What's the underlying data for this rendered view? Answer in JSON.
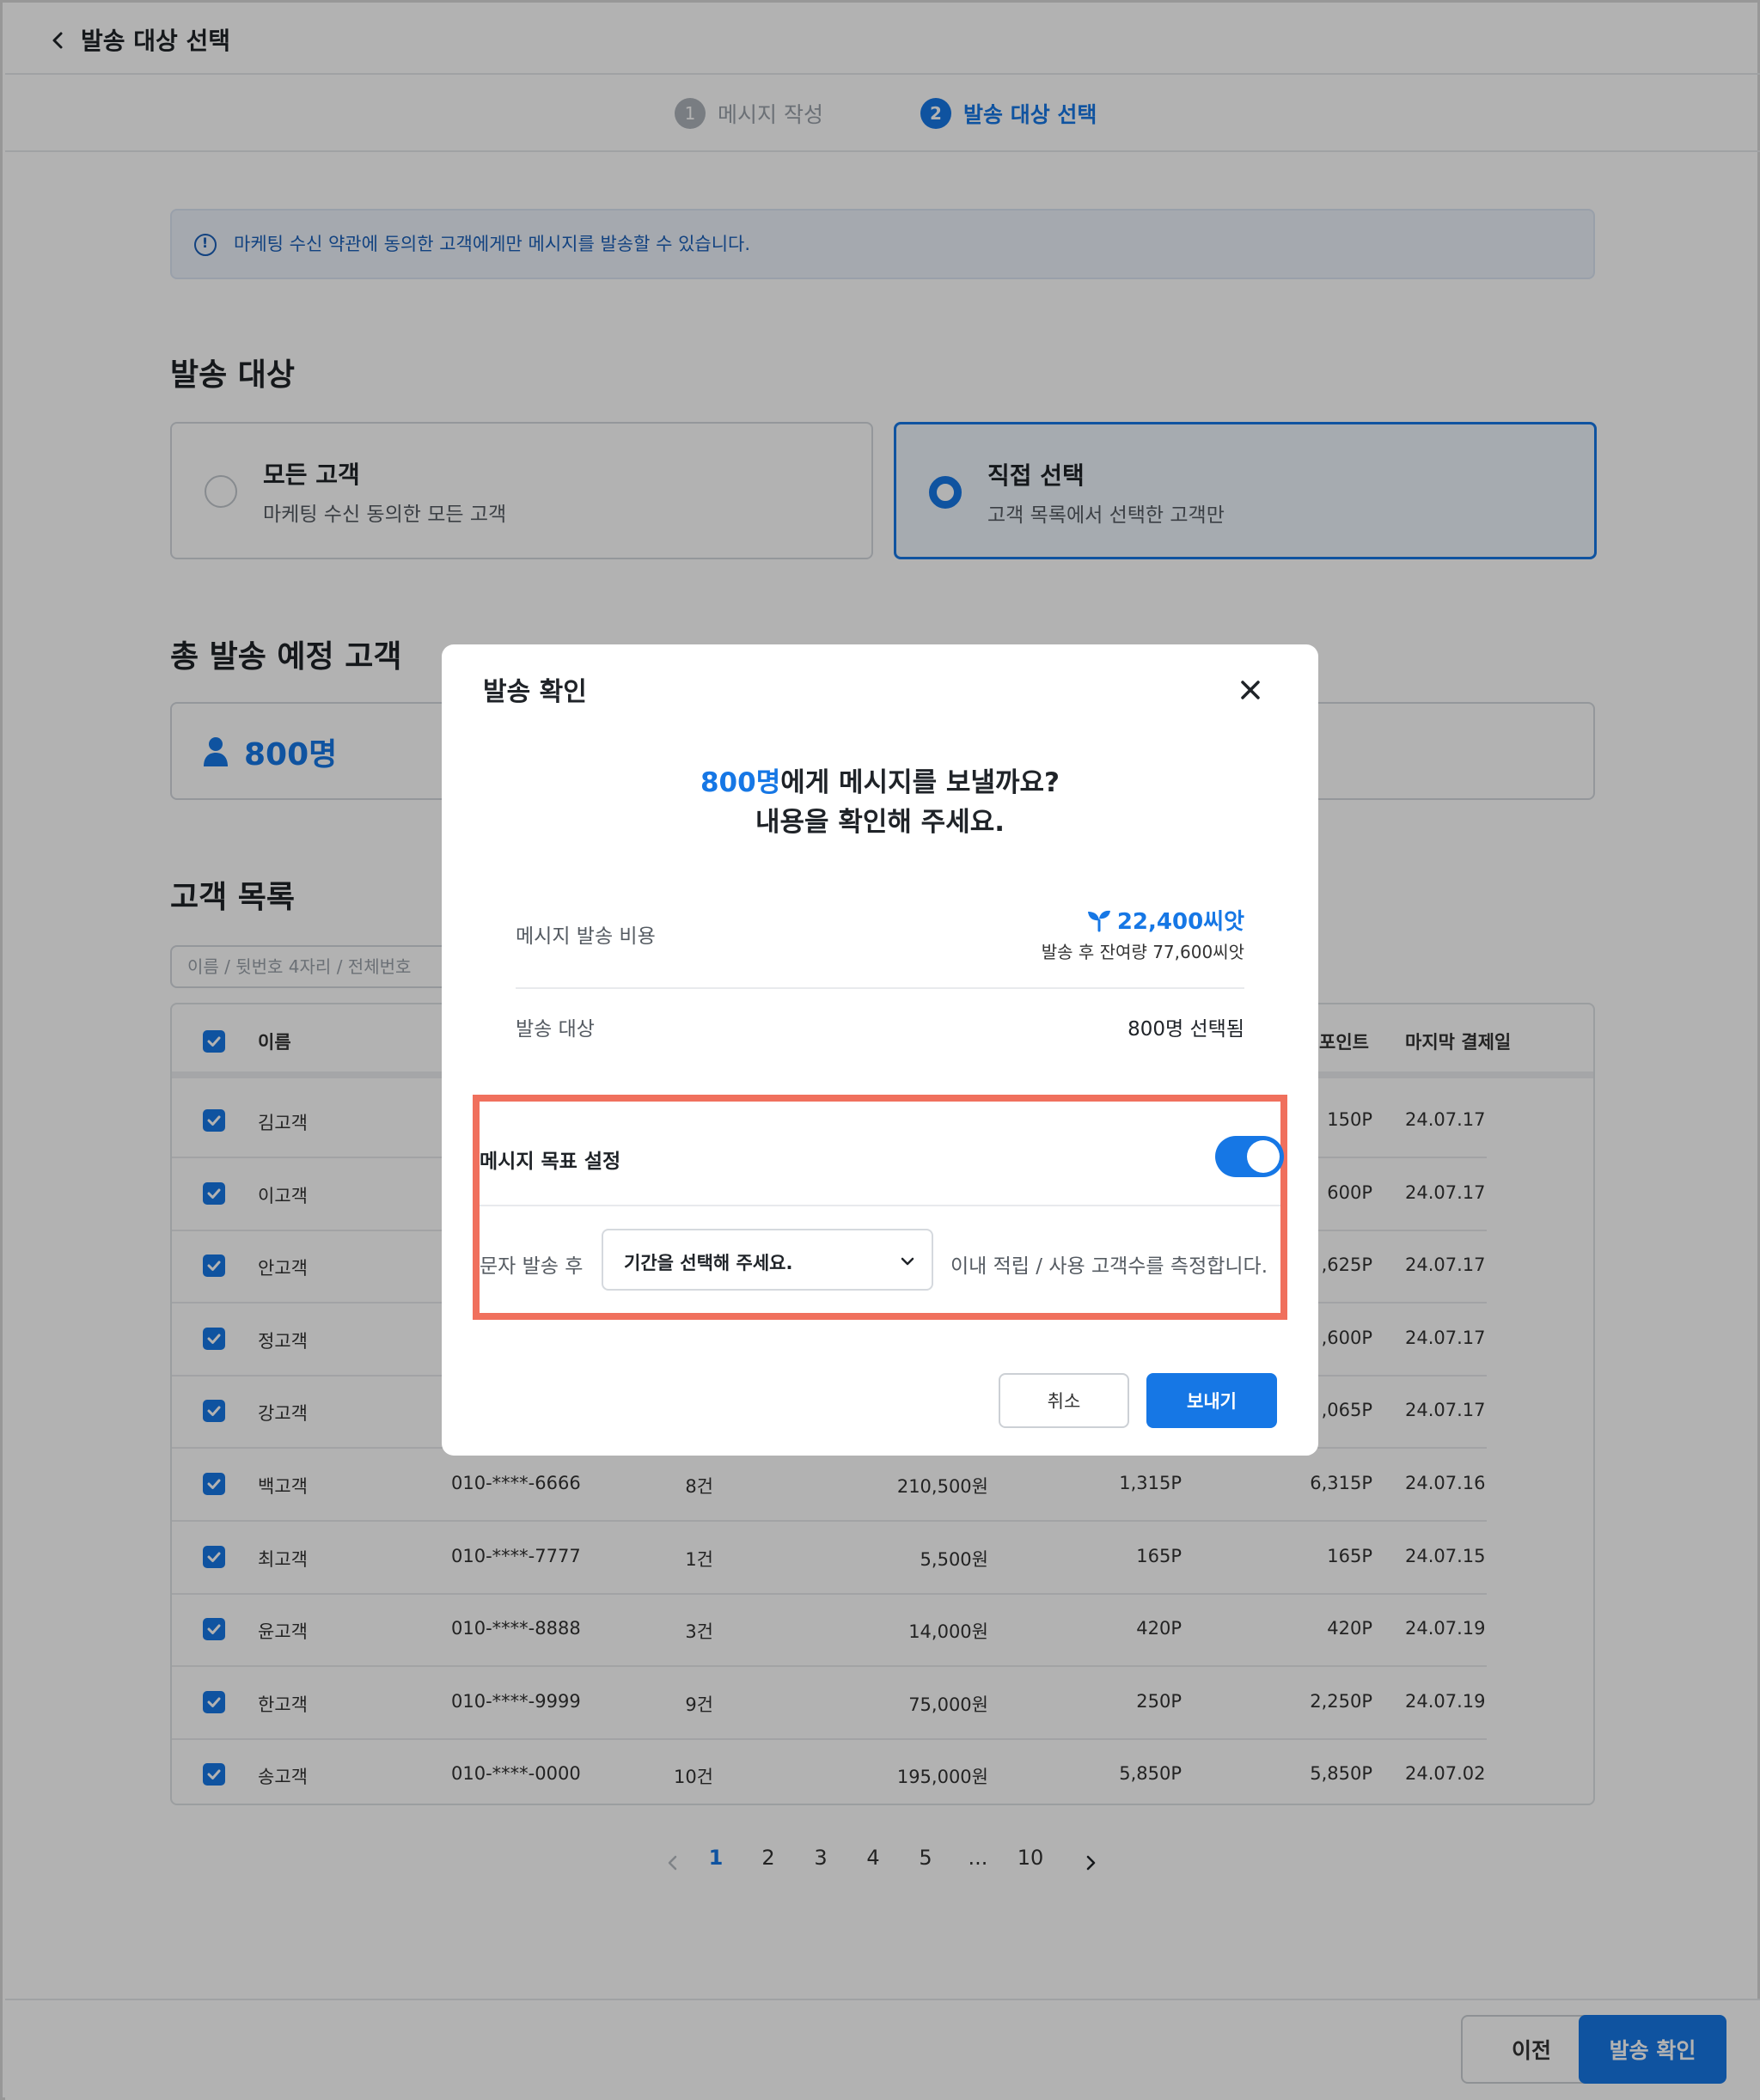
{
  "header": {
    "title": "발송 대상 선택"
  },
  "stepper": {
    "steps": [
      {
        "num": "1",
        "label": "메시지 작성"
      },
      {
        "num": "2",
        "label": "발송 대상 선택"
      }
    ]
  },
  "notice": {
    "text": "마케팅 수신 약관에 동의한 고객에게만 메시지를 발송할 수 있습니다."
  },
  "target": {
    "title": "발송 대상",
    "options": [
      {
        "title": "모든 고객",
        "desc": "마케팅 수신 동의한 모든 고객"
      },
      {
        "title": "직접 선택",
        "desc": "고객 목록에서 선택한 고객만"
      }
    ]
  },
  "total": {
    "title": "총 발송 예정 고객",
    "value": "800명"
  },
  "customers": {
    "title": "고객 목록",
    "search_placeholder": "이름 / 뒷번호 4자리 / 전체번호",
    "headers": {
      "name": "이름",
      "points": "포인트",
      "last_payment": "마지막 결제일"
    },
    "rows": [
      {
        "name": "김고객",
        "phone": "",
        "count": "",
        "amount": "",
        "earned": "",
        "points": "150P",
        "date": "24.07.17"
      },
      {
        "name": "이고객",
        "phone": "",
        "count": "",
        "amount": "",
        "earned": "",
        "points": "600P",
        "date": "24.07.17"
      },
      {
        "name": "안고객",
        "phone": "",
        "count": "",
        "amount": "",
        "earned": "",
        "points": ",625P",
        "date": "24.07.17"
      },
      {
        "name": "정고객",
        "phone": "",
        "count": "",
        "amount": "",
        "earned": "",
        "points": ",600P",
        "date": "24.07.17"
      },
      {
        "name": "강고객",
        "phone": "",
        "count": "",
        "amount": "",
        "earned": "",
        "points": ",065P",
        "date": "24.07.17"
      },
      {
        "name": "백고객",
        "phone": "010-****-6666",
        "count": "8건",
        "amount": "210,500원",
        "earned": "1,315P",
        "points": "6,315P",
        "date": "24.07.16"
      },
      {
        "name": "최고객",
        "phone": "010-****-7777",
        "count": "1건",
        "amount": "5,500원",
        "earned": "165P",
        "points": "165P",
        "date": "24.07.15"
      },
      {
        "name": "윤고객",
        "phone": "010-****-8888",
        "count": "3건",
        "amount": "14,000원",
        "earned": "420P",
        "points": "420P",
        "date": "24.07.19"
      },
      {
        "name": "한고객",
        "phone": "010-****-9999",
        "count": "9건",
        "amount": "75,000원",
        "earned": "250P",
        "points": "2,250P",
        "date": "24.07.19"
      },
      {
        "name": "송고객",
        "phone": "010-****-0000",
        "count": "10건",
        "amount": "195,000원",
        "earned": "5,850P",
        "points": "5,850P",
        "date": "24.07.02"
      }
    ]
  },
  "pagination": {
    "pages": [
      "1",
      "2",
      "3",
      "4",
      "5",
      "...",
      "10"
    ],
    "active": "1"
  },
  "footer": {
    "prev_label": "이전",
    "confirm_label": "발송 확인"
  },
  "modal": {
    "title": "발송 확인",
    "headline_count": "800명",
    "headline_rest": "에게 메시지를 보낼까요?",
    "headline_line2": "내용을 확인해 주세요.",
    "cost_label": "메시지 발송 비용",
    "cost_value": "22,400씨앗",
    "cost_remaining": "발송 후 잔여량 77,600씨앗",
    "target_label": "발송 대상",
    "target_value": "800명 선택됨",
    "goal_title": "메시지 목표 설정",
    "goal_enabled": true,
    "goal_pre": "문자 발송 후",
    "period_placeholder": "기간을 선택해 주세요.",
    "goal_post": "이내 적립 / 사용 고객수를 측정합니다.",
    "cancel_label": "취소",
    "send_label": "보내기"
  },
  "colors": {
    "accent": "#1677e5",
    "highlight": "#f0705d"
  }
}
